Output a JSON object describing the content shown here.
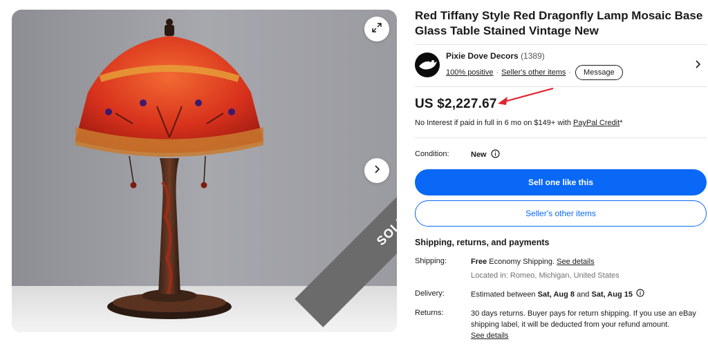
{
  "gallery": {
    "sold_label": "SOLD",
    "expand_icon": "expand-icon",
    "next_icon": "chevron-right-icon"
  },
  "listing": {
    "title": "Red Tiffany Style Red Dragonfly Lamp Mosaic Base Glass Table Stained Vintage New",
    "price": "US $2,227.67",
    "financing_text": "No Interest if paid in full in 6 mo on $149+ with ",
    "financing_link": "PayPal Credit",
    "financing_suffix": "*",
    "condition_label": "Condition:",
    "condition_value": "New"
  },
  "seller": {
    "name": "Pixie Dove Decors",
    "feedback_count": "(1389)",
    "positive": "100% positive",
    "other_items": "Seller's other items",
    "message_label": "Message"
  },
  "actions": {
    "primary_label": "Sell one like this",
    "secondary_label": "Seller's other items"
  },
  "shipping": {
    "heading": "Shipping, returns, and payments",
    "shipping_label": "Shipping:",
    "shipping_free": "Free",
    "shipping_method": " Economy Shipping. ",
    "shipping_link": "See details",
    "location": "Located in: Romeo, Michigan, United States",
    "delivery_label": "Delivery:",
    "delivery_prefix": "Estimated between ",
    "delivery_start": "Sat, Aug 8",
    "delivery_and": " and ",
    "delivery_end": "Sat, Aug 15",
    "returns_label": "Returns:",
    "returns_text": "30 days returns. Buyer pays for return shipping. If you use an eBay shipping label, it will be deducted from your refund amount.",
    "returns_link": "See details"
  },
  "colors": {
    "primary_blue": "#0968f6",
    "annotation_red": "#e0232e",
    "sold_ribbon": "#6b6b6b"
  }
}
